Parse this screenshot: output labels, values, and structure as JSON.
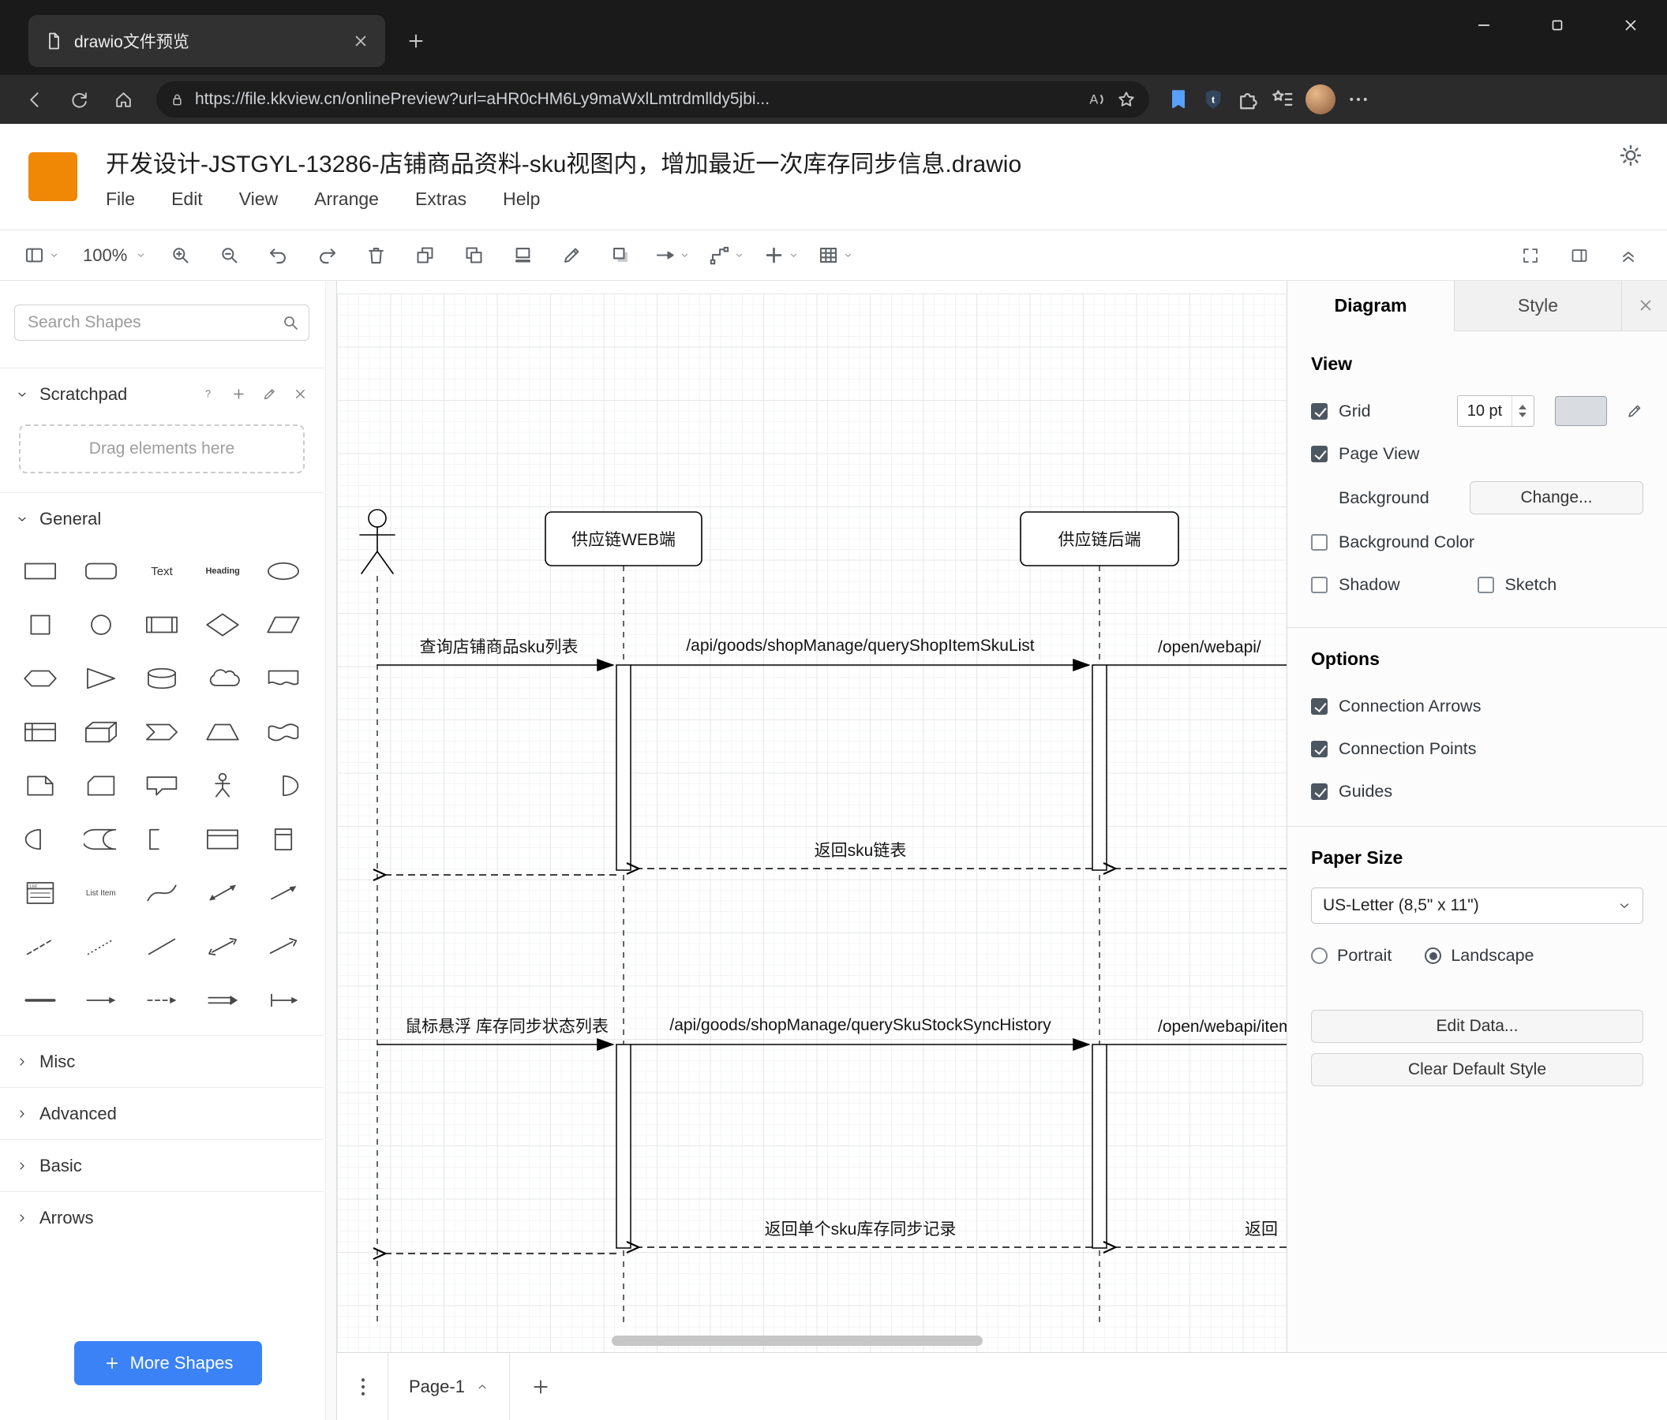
{
  "colors": {
    "accent_blue": "#3b82f6",
    "logo_orange": "#f08705",
    "selection_dark": "#4d5761"
  },
  "browser": {
    "tab_title": "drawio文件预览",
    "url": "https://file.kkview.cn/onlinePreview?url=aHR0cHM6Ly9maWxlLmtrdmlldy5jbi..."
  },
  "app": {
    "title": "开发设计-JSTGYL-13286-店铺商品资料-sku视图内，增加最近一次库存同步信息.drawio",
    "menus": [
      "File",
      "Edit",
      "View",
      "Arrange",
      "Extras",
      "Help"
    ],
    "toolbar": {
      "zoom_level": "100%",
      "items": [
        {
          "name": "view-panel",
          "dropdown": true
        },
        {
          "name": "zoom-level",
          "dropdown": true
        },
        {
          "name": "zoom-in"
        },
        {
          "name": "zoom-out"
        },
        {
          "name": "undo"
        },
        {
          "name": "redo"
        },
        {
          "name": "delete"
        },
        {
          "name": "to-front"
        },
        {
          "name": "to-back"
        },
        {
          "name": "fill-color"
        },
        {
          "name": "line-color"
        },
        {
          "name": "shadow"
        },
        {
          "name": "connection",
          "dropdown": true
        },
        {
          "name": "waypoints",
          "dropdown": true
        },
        {
          "name": "insert",
          "dropdown": true
        },
        {
          "name": "table",
          "dropdown": true
        }
      ],
      "right_items": [
        "fullscreen",
        "format-panel",
        "collapse"
      ]
    }
  },
  "sidebar": {
    "search_placeholder": "Search Shapes",
    "scratchpad_title": "Scratchpad",
    "drag_hint": "Drag elements here",
    "sections": [
      {
        "label": "General"
      },
      {
        "label": "Misc"
      },
      {
        "label": "Advanced"
      },
      {
        "label": "Basic"
      },
      {
        "label": "Arrows"
      }
    ],
    "shapes": [
      {
        "name": "rectangle"
      },
      {
        "name": "rounded-rectangle"
      },
      {
        "name": "text",
        "label": "Text"
      },
      {
        "name": "heading",
        "label": "Heading"
      },
      {
        "name": "ellipse"
      },
      {
        "name": "square"
      },
      {
        "name": "circle"
      },
      {
        "name": "process"
      },
      {
        "name": "diamond"
      },
      {
        "name": "parallelogram"
      },
      {
        "name": "hexagon"
      },
      {
        "name": "triangle"
      },
      {
        "name": "cylinder"
      },
      {
        "name": "cloud"
      },
      {
        "name": "document"
      },
      {
        "name": "internal-storage"
      },
      {
        "name": "cube"
      },
      {
        "name": "step"
      },
      {
        "name": "trapezoid"
      },
      {
        "name": "tape"
      },
      {
        "name": "note"
      },
      {
        "name": "card"
      },
      {
        "name": "callout"
      },
      {
        "name": "actor"
      },
      {
        "name": "or"
      },
      {
        "name": "and"
      },
      {
        "name": "data-storage"
      },
      {
        "name": "annotation"
      },
      {
        "name": "container"
      },
      {
        "name": "vertical-container"
      },
      {
        "name": "list",
        "label": "List"
      },
      {
        "name": "list-item",
        "label": "List Item"
      },
      {
        "name": "curve"
      },
      {
        "name": "bidirectional-arrow"
      },
      {
        "name": "arrow"
      },
      {
        "name": "dashed-line"
      },
      {
        "name": "dotted-line"
      },
      {
        "name": "line"
      },
      {
        "name": "bidirectional-connector"
      },
      {
        "name": "directional-connector"
      },
      {
        "name": "horizontal-line"
      },
      {
        "name": "thin-arrow"
      },
      {
        "name": "dashed-thin-arrow"
      },
      {
        "name": "double-arrow"
      },
      {
        "name": "connector"
      }
    ],
    "more_shapes_label": "More Shapes"
  },
  "canvas": {
    "participants": [
      {
        "label": "供应链WEB端"
      },
      {
        "label": "供应链后端"
      }
    ],
    "messages": {
      "query_sku_list": "查询店铺商品sku列表",
      "api_query_shop_item_sku_list": "/api/goods/shopManage/queryShopItemSkuList",
      "open_webapi_1": "/open/webapi/",
      "return_sku_list": "返回sku链表",
      "hover_stock_sync": "鼠标悬浮 库存同步状态列表",
      "api_query_sku_stock_sync_history": "/api/goods/shopManage/querySkuStockSyncHistory",
      "open_webapi_2": "/open/webapi/item",
      "return_single_sku": "返回单个sku库存同步记录",
      "return_clipped": "返回"
    }
  },
  "panel": {
    "tabs": [
      "Diagram",
      "Style"
    ],
    "view": {
      "heading": "View",
      "grid": "Grid",
      "grid_value": "10 pt",
      "page_view": "Page View",
      "background": "Background",
      "change": "Change...",
      "background_color": "Background Color",
      "shadow": "Shadow",
      "sketch": "Sketch"
    },
    "options": {
      "heading": "Options",
      "items": [
        "Connection Arrows",
        "Connection Points",
        "Guides"
      ]
    },
    "paper": {
      "heading": "Paper Size",
      "size": "US-Letter (8,5\" x 11\")",
      "portrait": "Portrait",
      "landscape": "Landscape"
    },
    "buttons": [
      "Edit Data...",
      "Clear Default Style"
    ]
  },
  "footer": {
    "page_label": "Page-1"
  }
}
